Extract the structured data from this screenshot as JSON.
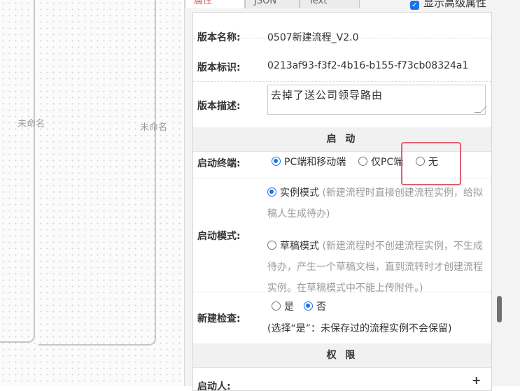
{
  "canvas": {
    "lane_labels": [
      "未命名",
      "未命名"
    ]
  },
  "tabs": [
    {
      "label": "属性",
      "active": true
    },
    {
      "label": "JSON",
      "active": false
    },
    {
      "label": "Text",
      "active": false
    }
  ],
  "advanced": {
    "label": "显示高级属性",
    "checked": true
  },
  "fields": {
    "version_name": {
      "label": "版本名称:",
      "value": "0507新建流程_V2.0"
    },
    "version_id": {
      "label": "版本标识:",
      "value": "0213af93-f3f2-4b16-b155-f73cb08324a1"
    },
    "version_desc": {
      "label": "版本描述:",
      "value": "去掉了送公司领导路由"
    }
  },
  "start_section": {
    "title": "启 动"
  },
  "start_terminal": {
    "label": "启动终端:",
    "options": [
      {
        "label": "PC端和移动端",
        "selected": true
      },
      {
        "label": "仅PC端",
        "selected": false
      },
      {
        "label": "无",
        "selected": false
      }
    ]
  },
  "start_mode": {
    "label": "启动模式:",
    "options": [
      {
        "label": "实例模式",
        "hint": "(新建流程时直接创建流程实例，给拟稿人生成待办)",
        "selected": true
      },
      {
        "label": "草稿模式",
        "hint": "(新建流程时不创建流程实例，不生成待办，产生一个草稿文档，直到流转时才创建流程实例。在草稿模式中不能上传附件。)",
        "selected": false
      }
    ]
  },
  "new_check": {
    "label": "新建检查:",
    "options": [
      {
        "label": "是",
        "selected": false
      },
      {
        "label": "否",
        "selected": true
      }
    ],
    "note": "(选择“是”：未保存过的流程实例不会保留)"
  },
  "permission_section": {
    "title": "权 限"
  },
  "initiator": {
    "label": "启动人:",
    "add": "+"
  },
  "colors": {
    "accent": "#1a73e8",
    "highlight": "#e0606e",
    "active_tab": "#d9534f"
  }
}
